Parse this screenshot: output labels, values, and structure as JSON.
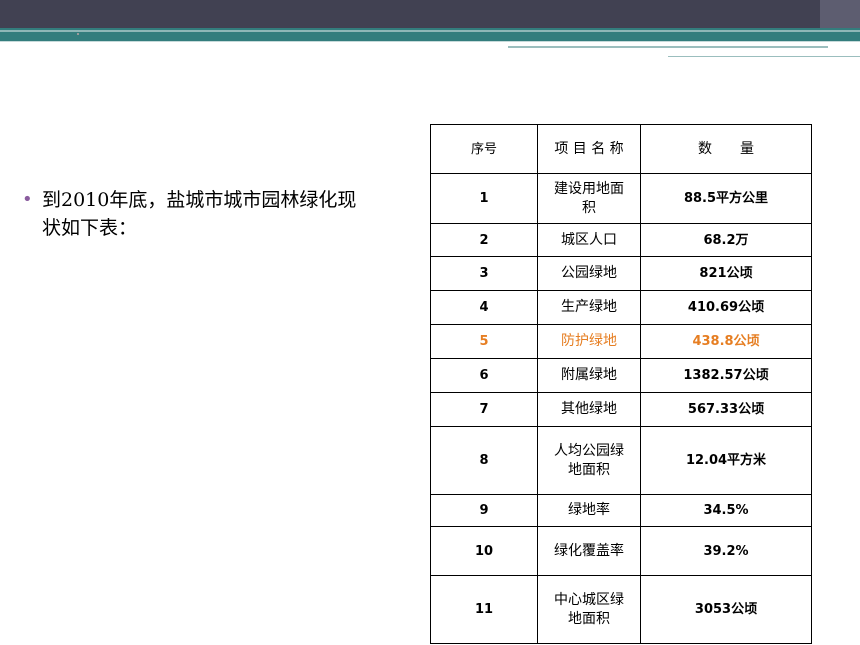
{
  "bullet": {
    "text": "到2010年底，盐城市城市园林绿化现状如下表："
  },
  "table": {
    "headers": {
      "index": "序号",
      "name": "项 目 名 称",
      "value": "数　　量"
    },
    "rows": [
      {
        "index": "1",
        "name": "建设用地面积",
        "value": "88.5平方公里"
      },
      {
        "index": "2",
        "name": "城区人口",
        "value": "68.2万"
      },
      {
        "index": "3",
        "name": "公园绿地",
        "value": "821公顷"
      },
      {
        "index": "4",
        "name": "生产绿地",
        "value": "410.69公顷"
      },
      {
        "index": "5",
        "name": "防护绿地",
        "value": "438.8公顷"
      },
      {
        "index": "6",
        "name": "附属绿地",
        "value": "1382.57公顷"
      },
      {
        "index": "7",
        "name": "其他绿地",
        "value": "567.33公顷"
      },
      {
        "index": "8",
        "name": "人均公园绿地面积",
        "value": "12.04平方米"
      },
      {
        "index": "9",
        "name": "绿地率",
        "value": "34.5%"
      },
      {
        "index": "10",
        "name": "绿化覆盖率",
        "value": "39.2%"
      },
      {
        "index": "11",
        "name": "中心城区绿地面积",
        "value": "3053公顷"
      }
    ]
  },
  "colors": {
    "header_dark": "#414152",
    "header_teal": "#337d7d",
    "bullet": "#8a5c9e",
    "highlight": "#e67e22"
  },
  "icons": {
    "bullet": "bullet-dot-icon"
  }
}
